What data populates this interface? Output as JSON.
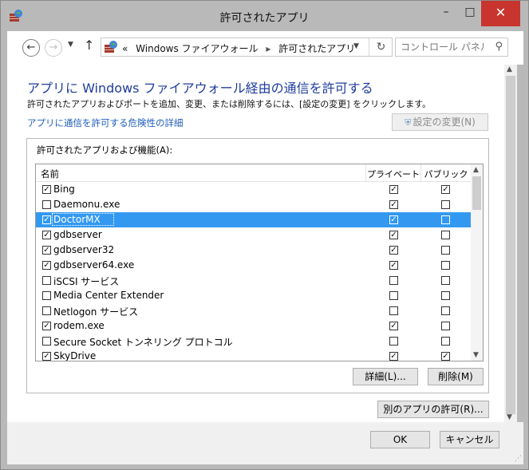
{
  "window": {
    "title": "許可されたアプリ",
    "controls": {
      "minimize": "–",
      "maximize": "□",
      "close": "✕"
    }
  },
  "address_bar": {
    "prefix": "«",
    "breadcrumb": [
      "Windows ファイアウォール",
      "許可されたアプリ"
    ],
    "separator": "▸",
    "search_placeholder": "コントロール パネル..."
  },
  "content": {
    "heading": "アプリに Windows ファイアウォール経由の通信を許可する",
    "subtitle": "許可されたアプリおよびポートを追加、変更、または削除するには、[設定の変更] をクリックします。",
    "risk_link": "アプリに通信を許可する危険性の詳細",
    "change_settings_button": "設定の変更(N)",
    "group_label": "許可されたアプリおよび機能(A):",
    "columns": {
      "name": "名前",
      "private": "プライベート",
      "public": "パブリック"
    },
    "rows": [
      {
        "name": "Bing",
        "enabled": true,
        "private": true,
        "public": true
      },
      {
        "name": "Daemonu.exe",
        "enabled": false,
        "private": true,
        "public": false
      },
      {
        "name": "DoctorMX",
        "enabled": true,
        "private": true,
        "public": false,
        "selected": true
      },
      {
        "name": "gdbserver",
        "enabled": true,
        "private": true,
        "public": false
      },
      {
        "name": "gdbserver32",
        "enabled": true,
        "private": true,
        "public": false
      },
      {
        "name": "gdbserver64.exe",
        "enabled": true,
        "private": true,
        "public": false
      },
      {
        "name": "iSCSI サービス",
        "enabled": false,
        "private": false,
        "public": false
      },
      {
        "name": "Media Center Extender",
        "enabled": false,
        "private": false,
        "public": false
      },
      {
        "name": "Netlogon サービス",
        "enabled": false,
        "private": false,
        "public": false
      },
      {
        "name": "rodem.exe",
        "enabled": true,
        "private": true,
        "public": false
      },
      {
        "name": "Secure Socket トンネリング プロトコル",
        "enabled": false,
        "private": false,
        "public": false
      },
      {
        "name": "SkyDrive",
        "enabled": true,
        "private": true,
        "public": true
      }
    ],
    "details_button": "詳細(L)...",
    "remove_button": "削除(M)",
    "allow_other_button": "別のアプリの許可(R)..."
  },
  "footer": {
    "ok_button": "OK",
    "cancel_button": "キャンセル"
  },
  "colors": {
    "accent_heading": "#1e3d9c",
    "link": "#1e5dbb",
    "selection": "#3399f0",
    "close_button": "#c7352e"
  },
  "icons": [
    "firewall-app-icon",
    "back-arrow-icon",
    "forward-arrow-icon",
    "up-arrow-icon",
    "refresh-icon",
    "search-icon",
    "shield-icon",
    "checkbox-icon"
  ]
}
